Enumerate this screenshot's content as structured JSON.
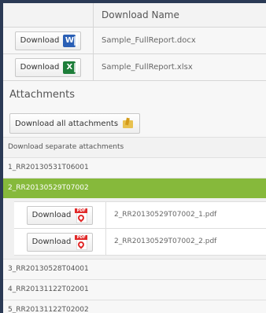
{
  "table": {
    "header": "Download Name",
    "rows": [
      {
        "button": "Download",
        "icon": "word-icon",
        "name": "Sample_FullReport.docx"
      },
      {
        "button": "Download",
        "icon": "excel-icon",
        "name": "Sample_FullReport.xlsx"
      }
    ]
  },
  "attachments": {
    "title": "Attachments",
    "download_all": "Download all attachments",
    "separate_label": "Download separate attachments",
    "items": [
      "1_RR20130531T06001",
      "2_RR20130529T07002",
      "3_RR20130528T04001",
      "4_RR20131122T02001",
      "5_RR20131122T02002"
    ],
    "selected_index": 1,
    "expanded_files": [
      {
        "button": "Download",
        "icon": "pdf-icon",
        "name": "2_RR20130529T07002_1.pdf"
      },
      {
        "button": "Download",
        "icon": "pdf-icon",
        "name": "2_RR20130529T07002_2.pdf"
      }
    ]
  },
  "colors": {
    "background": "#2b3a55",
    "selected_row": "#86b93b",
    "word": "#2a5fb5",
    "excel": "#1e7e3a",
    "pdf": "#e12a2a"
  }
}
